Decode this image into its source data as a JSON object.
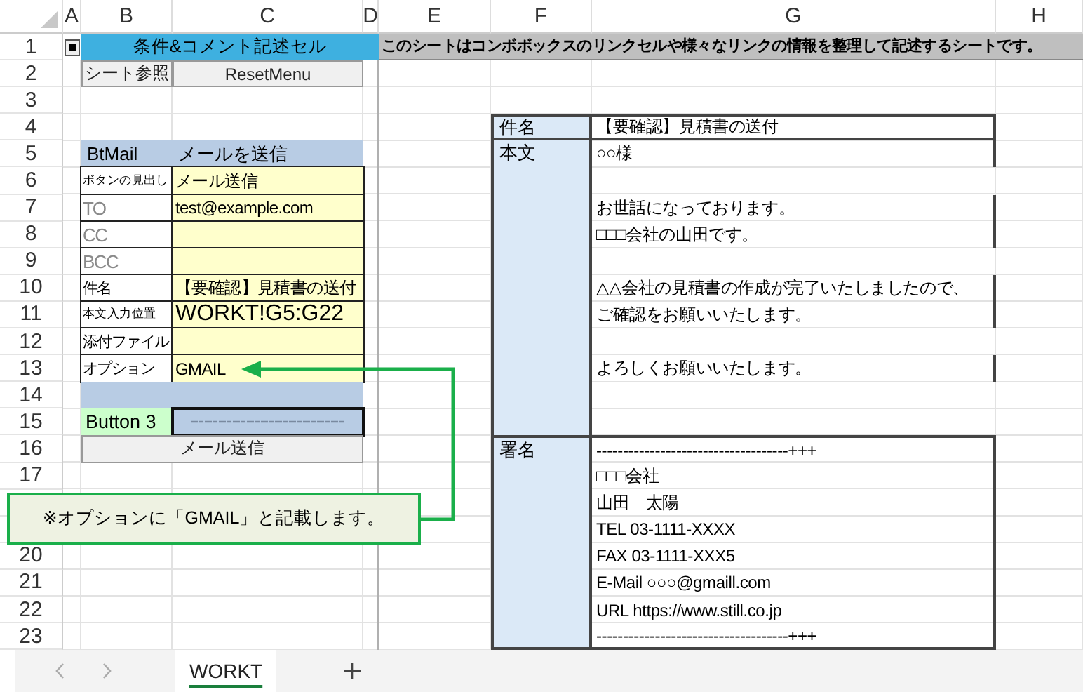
{
  "columns": [
    "A",
    "B",
    "C",
    "D",
    "E",
    "F",
    "G",
    "H"
  ],
  "rows": [
    {
      "label": "1"
    },
    {
      "label": "2"
    },
    {
      "label": "3"
    },
    {
      "label": "4"
    },
    {
      "label": "5"
    },
    {
      "label": "6"
    },
    {
      "label": "7"
    },
    {
      "label": "8"
    },
    {
      "label": "9"
    },
    {
      "label": "10"
    },
    {
      "label": "11"
    },
    {
      "label": "12"
    },
    {
      "label": "13"
    },
    {
      "label": "14"
    },
    {
      "label": "15"
    },
    {
      "label": "16"
    },
    {
      "label": "17"
    },
    {
      "covered": true
    },
    {
      "covered": true
    },
    {
      "label": "20"
    },
    {
      "label": "21"
    },
    {
      "label": "22"
    },
    {
      "label": "23"
    }
  ],
  "title_cell": "条件&コメント記述セル",
  "note": "このシートはコンボボックスのリンクセルや様々なリンクの情報を整理して記述するシートです。",
  "menu_buttons": [
    {
      "label": "シート参照"
    },
    {
      "label": "ResetMenu"
    }
  ],
  "mail_settings": {
    "name": "BtMail",
    "action": "メールを送信",
    "fields": [
      {
        "label": "ボタンの見出し",
        "kind": "small",
        "value": "メール送信",
        "large_value": false
      },
      {
        "label": "TO",
        "kind": "muted",
        "value": "test@example.com",
        "large_value": false
      },
      {
        "label": "CC",
        "kind": "muted"
      },
      {
        "label": "BCC",
        "kind": "muted"
      },
      {
        "label": "件名",
        "kind": "normal",
        "value": "【要確認】見積書の送付",
        "large_value": false
      },
      {
        "label": "本文入力位置",
        "kind": "small",
        "value": "WORKT!G5:G22",
        "large_value": true
      },
      {
        "label": "添付ファイル",
        "kind": "normal"
      },
      {
        "label": "オプション",
        "kind": "normal",
        "value": "GMAIL",
        "large_value": false
      }
    ],
    "button_name": "Button 3",
    "send_button": "メール送信"
  },
  "preview": {
    "subject_label": "件名",
    "subject": "【要確認】見積書の送付",
    "body_label": "本文",
    "body_paragraphs": [
      [
        "○○様"
      ],
      [
        "お世話になっております。",
        "□□□会社の山田です。"
      ],
      [
        "△△会社の見積書の作成が完了いたしましたので、",
        "ご確認をお願いいたします。"
      ],
      [
        "よろしくお願いいたします。"
      ]
    ],
    "signature_label": "署名",
    "signature_lines": [
      "------------------------------------+++",
      "□□□会社",
      "山田　太陽",
      "TEL 03-1111-XXXX",
      "FAX 03-1111-XXX5",
      "E-Mail  ○○○@gmaill.com",
      "URL    https://www.still.co.jp",
      "------------------------------------+++"
    ]
  },
  "callout": "※オプションに「GMAIL」と記載します。",
  "sheet_tabs": [
    {
      "label": "WORKT",
      "selected": true
    }
  ]
}
